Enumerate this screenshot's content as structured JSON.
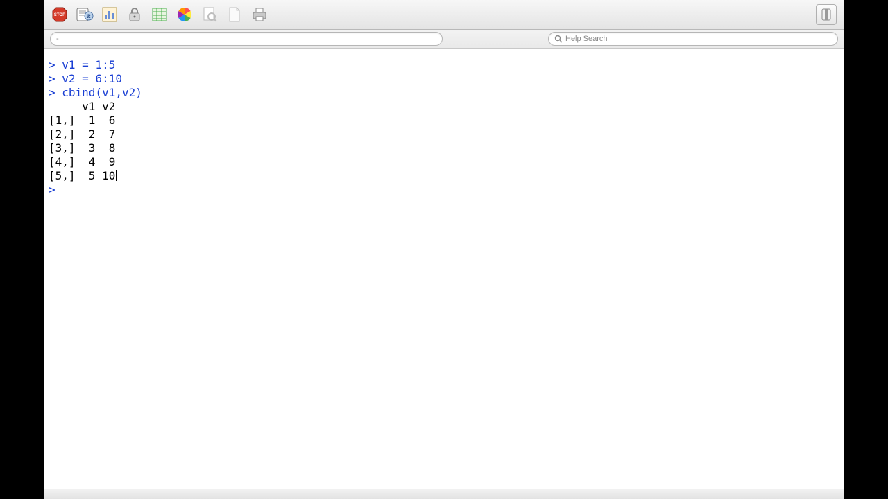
{
  "toolbar": {
    "icons": [
      "stop-icon",
      "source-icon",
      "barchart-icon",
      "lock-icon",
      "spreadsheet-icon",
      "colorwheel-icon",
      "preview-icon",
      "newdoc-icon",
      "print-icon"
    ],
    "right_icon": "sidebar-toggle-icon"
  },
  "expression_bar": {
    "value": "-"
  },
  "help_search": {
    "placeholder": "Help Search",
    "value": ""
  },
  "console": {
    "prompt": ">",
    "lines": [
      {
        "type": "cmd",
        "text": "v1 = 1:5"
      },
      {
        "type": "cmd",
        "text": "v2 = 6:10"
      },
      {
        "type": "cmd",
        "text": "cbind(v1,v2)"
      },
      {
        "type": "out",
        "text": "     v1 v2"
      },
      {
        "type": "out",
        "text": "[1,]  1  6"
      },
      {
        "type": "out",
        "text": "[2,]  2  7"
      },
      {
        "type": "out",
        "text": "[3,]  3  8"
      },
      {
        "type": "out",
        "text": "[4,]  4  9"
      },
      {
        "type": "out",
        "text": "[5,]  5 10"
      }
    ],
    "cursor_after_output": true
  },
  "colors": {
    "prompt": "#1a3fd4",
    "window_bg": "#ffffff"
  }
}
